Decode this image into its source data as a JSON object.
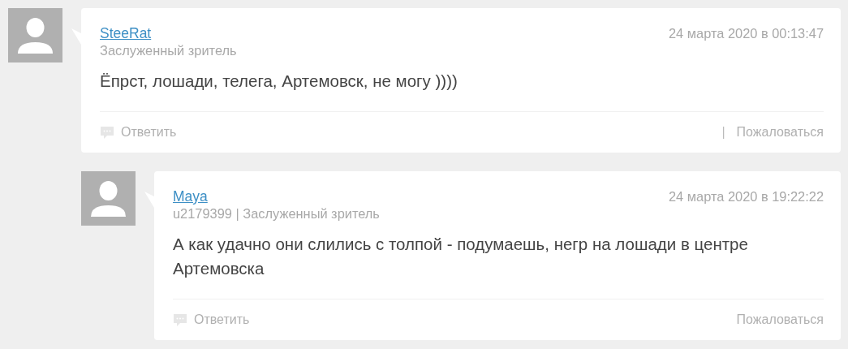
{
  "comments": [
    {
      "author": "SteeRat",
      "meta": "Заслуженный зритель",
      "date": "24 марта 2020 в 00:13:47",
      "text": "Ёпрст, лошади, телега, Артемовск, не могу ))))",
      "reply": "Ответить",
      "separator": "|",
      "report": "Пожаловаться",
      "children": [
        {
          "author": "Maya",
          "meta": "u2179399 | Заслуженный зритель",
          "date": "24 марта 2020 в 19:22:22",
          "text": "А как удачно они слились с толпой - подумаешь, негр на лошади в центре Артемовска",
          "reply": "Ответить",
          "report": "Пожаловаться"
        }
      ]
    }
  ]
}
